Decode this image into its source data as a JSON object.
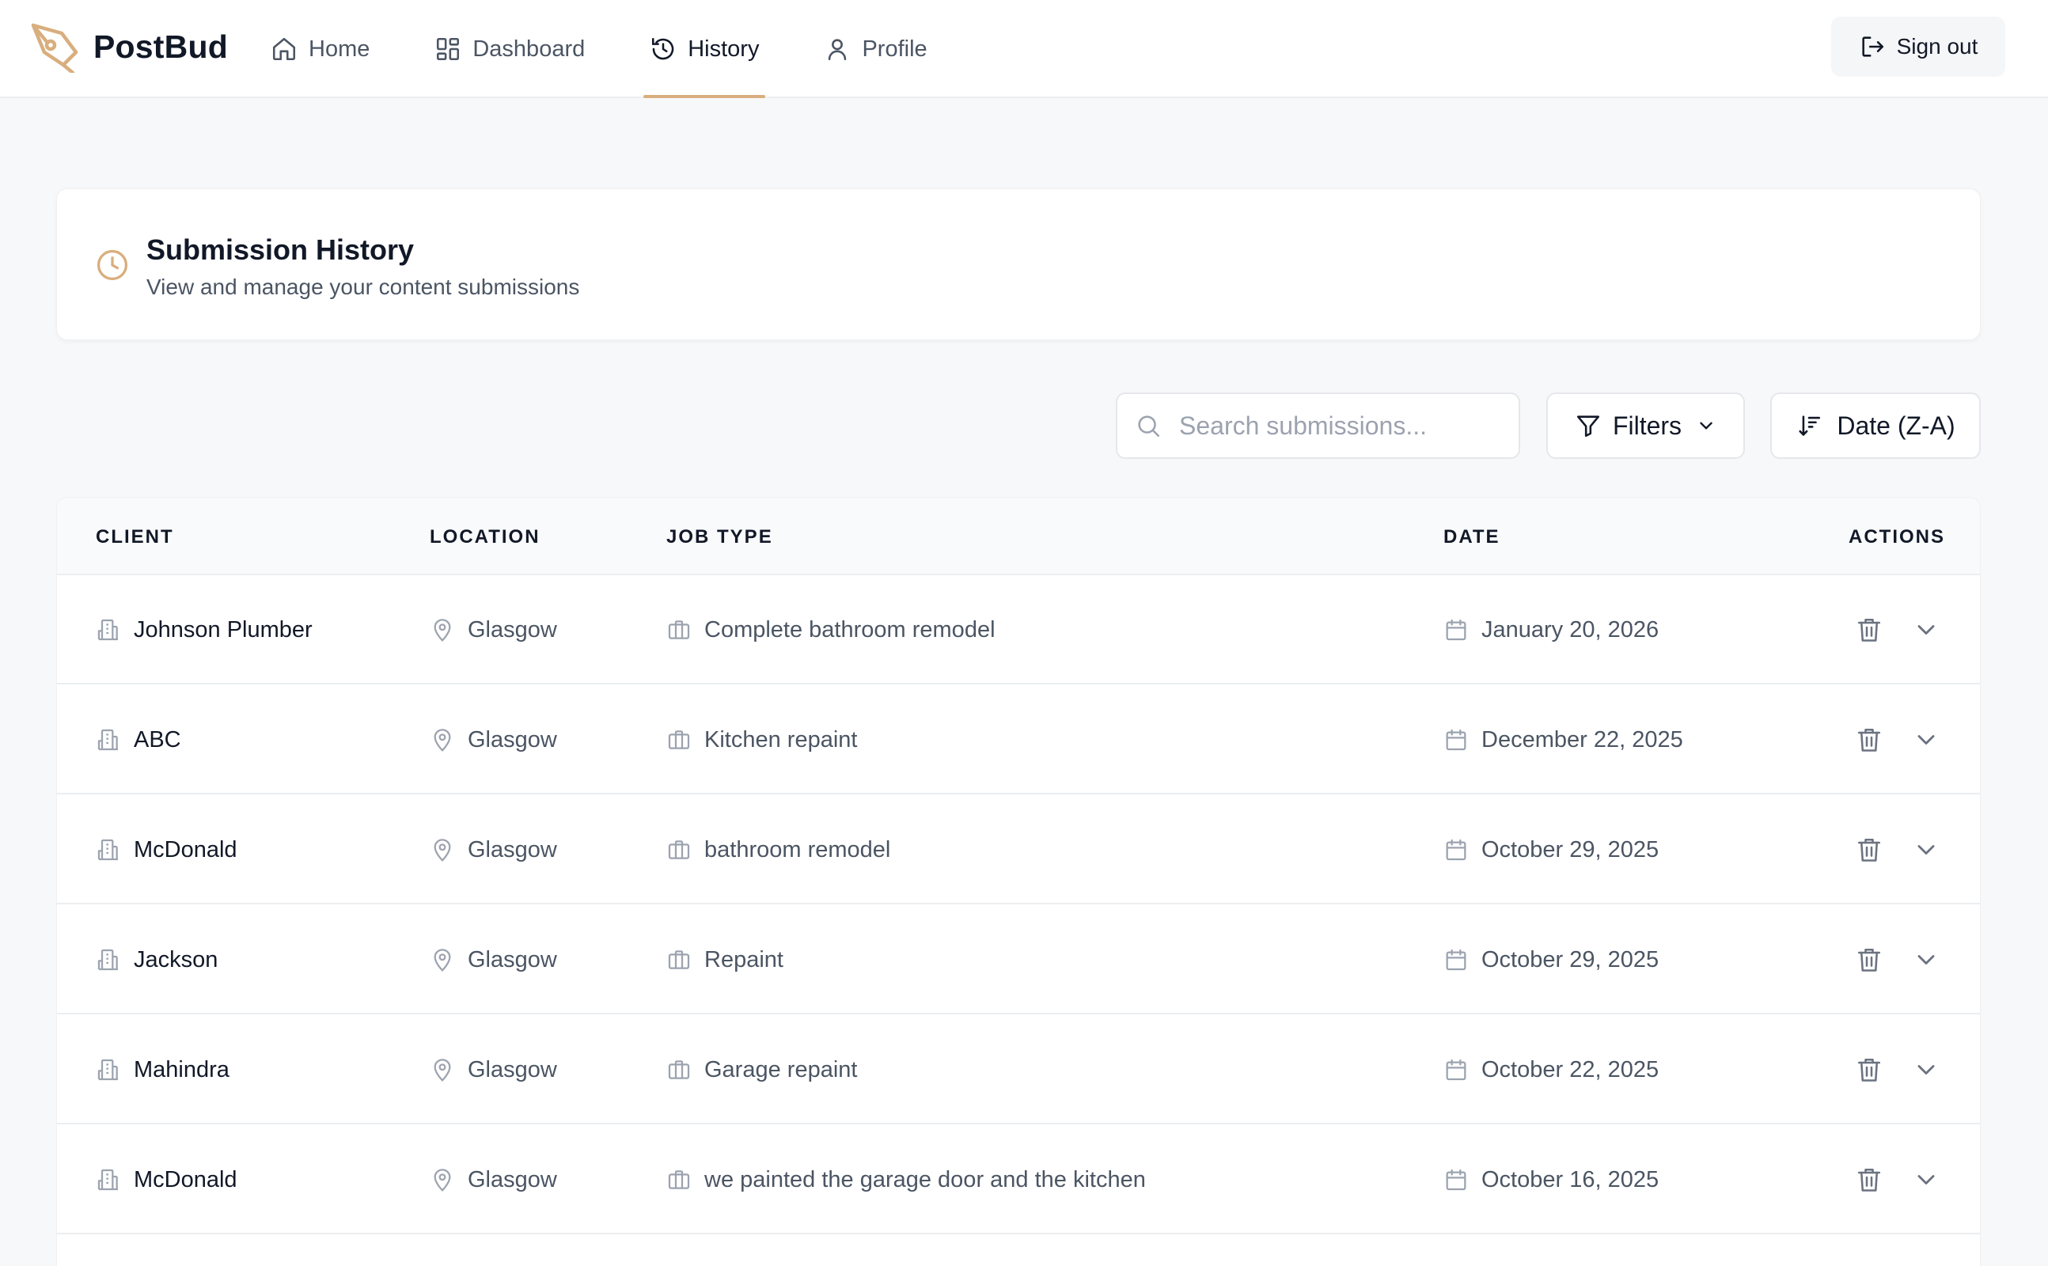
{
  "app": {
    "name": "PostBud",
    "accent": "#d9ae7e"
  },
  "nav": {
    "items": [
      {
        "label": "Home",
        "icon": "home-icon",
        "active": false
      },
      {
        "label": "Dashboard",
        "icon": "dashboard-icon",
        "active": false
      },
      {
        "label": "History",
        "icon": "history-icon",
        "active": true
      },
      {
        "label": "Profile",
        "icon": "user-icon",
        "active": false
      }
    ],
    "signout_label": "Sign out"
  },
  "page": {
    "title": "Submission History",
    "subtitle": "View and manage your content submissions"
  },
  "controls": {
    "search_placeholder": "Search submissions...",
    "filters_label": "Filters",
    "sort_label": "Date (Z-A)"
  },
  "table": {
    "columns": {
      "client": "CLIENT",
      "location": "LOCATION",
      "job_type": "JOB TYPE",
      "date": "DATE",
      "actions": "ACTIONS"
    },
    "rows": [
      {
        "client": "Johnson Plumber",
        "location": "Glasgow",
        "job_type": "Complete bathroom remodel",
        "date": "January 20, 2026"
      },
      {
        "client": "ABC",
        "location": "Glasgow",
        "job_type": "Kitchen repaint",
        "date": "December 22, 2025"
      },
      {
        "client": "McDonald",
        "location": "Glasgow",
        "job_type": "bathroom remodel",
        "date": "October 29, 2025"
      },
      {
        "client": "Jackson",
        "location": "Glasgow",
        "job_type": "Repaint",
        "date": "October 29, 2025"
      },
      {
        "client": "Mahindra",
        "location": "Glasgow",
        "job_type": "Garage repaint",
        "date": "October 22, 2025"
      },
      {
        "client": "McDonald",
        "location": "Glasgow",
        "job_type": "we painted the garage door and the kitchen",
        "date": "October 16, 2025"
      }
    ]
  }
}
